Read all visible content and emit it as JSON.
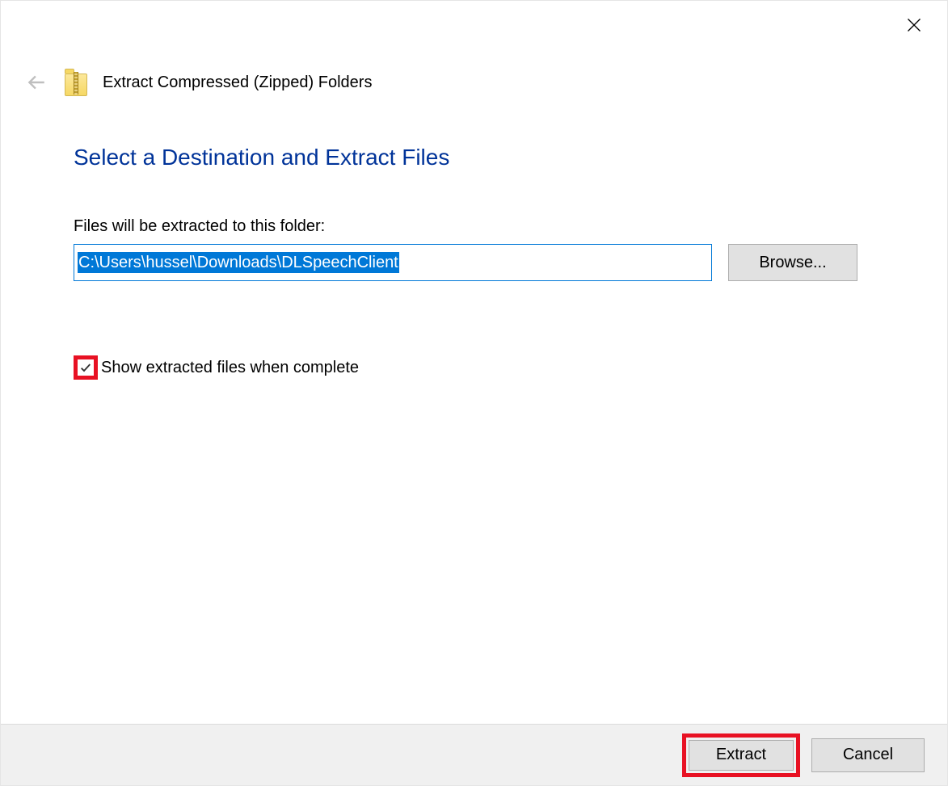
{
  "wizard": {
    "title": "Extract Compressed (Zipped) Folders"
  },
  "page": {
    "heading": "Select a Destination and Extract Files",
    "field_label": "Files will be extracted to this folder:",
    "path_value": "C:\\Users\\hussel\\Downloads\\DLSpeechClient",
    "browse_label": "Browse...",
    "checkbox_label": "Show extracted files when complete",
    "checkbox_checked": true
  },
  "footer": {
    "extract_label": "Extract",
    "cancel_label": "Cancel"
  }
}
